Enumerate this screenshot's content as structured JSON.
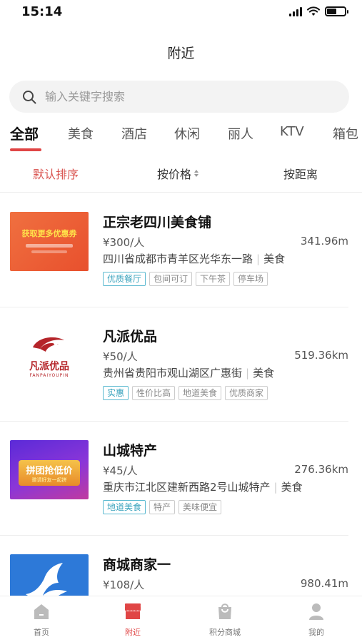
{
  "status_bar": {
    "time": "15:14"
  },
  "header": {
    "title": "附近"
  },
  "search": {
    "placeholder": "输入关键字搜索"
  },
  "categories": [
    "全部",
    "美食",
    "酒店",
    "休闲",
    "丽人",
    "KTV",
    "箱包"
  ],
  "sort": {
    "default": "默认排序",
    "price": "按价格",
    "distance": "按距离"
  },
  "shops": [
    {
      "name": "正宗老四川美食铺",
      "price": "¥300/人",
      "distance": "341.96m",
      "address": "四川省成都市青羊区光华东一路",
      "category": "美食",
      "tags": [
        "优质餐厅",
        "包间可订",
        "下午茶",
        "停车场"
      ],
      "image_text": "获取更多优惠券"
    },
    {
      "name": "凡派优品",
      "price": "¥50/人",
      "distance": "519.36km",
      "address": "贵州省贵阳市观山湖区广惠街",
      "category": "美食",
      "tags": [
        "实惠",
        "性价比高",
        "地道美食",
        "优质商家"
      ],
      "image_text": "凡派优品",
      "image_text_en": "FANPAIYOUPIN"
    },
    {
      "name": "山城特产",
      "price": "¥45/人",
      "distance": "276.36km",
      "address": "重庆市江北区建新西路2号山城特产",
      "category": "美食",
      "tags": [
        "地道美食",
        "特产",
        "美味便宜"
      ],
      "image_text": "拼团抢低价",
      "image_subtext": "邀请好友一起拼"
    },
    {
      "name": "商城商家一",
      "price": "¥108/人",
      "distance": "980.41m",
      "address": "",
      "category": "",
      "tags": []
    }
  ],
  "tabbar": [
    {
      "label": "首页",
      "icon": "home-icon"
    },
    {
      "label": "附近",
      "icon": "shop-icon"
    },
    {
      "label": "积分商城",
      "icon": "bag-icon"
    },
    {
      "label": "我的",
      "icon": "user-icon"
    }
  ],
  "colors": {
    "accent": "#e04545",
    "tag_highlight": "#3aa3bd"
  }
}
